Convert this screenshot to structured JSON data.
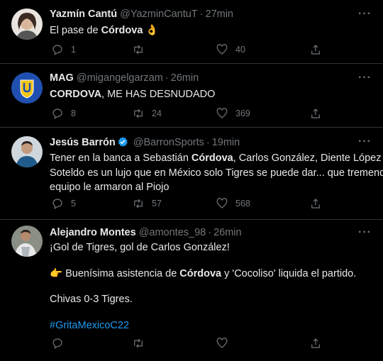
{
  "tweets": [
    {
      "name": "Yazmín Cantú",
      "handle": "@YazminCantuT",
      "time": "27min",
      "text_pre": "El pase de ",
      "text_bold": "Córdova",
      "text_post": "",
      "emoji": "👌",
      "replies": "1",
      "retweets": "",
      "likes": "40"
    },
    {
      "name": "MAG",
      "handle": "@migangelgarzam",
      "time": "26min",
      "text_bold": "CORDOVA",
      "text_post": ", ME HAS DESNUDADO",
      "replies": "8",
      "retweets": "24",
      "likes": "369"
    },
    {
      "name": "Jesús Barrón",
      "handle": "@BarronSports",
      "time": "19min",
      "line1_pre": "Tener en la banca a Sebastián ",
      "line1_bold": "Córdova",
      "line1_post": ", Carlos González, Diente López y",
      "line2": "Soteldo es un lujo que en México solo Tigres se puede dar... que tremendo",
      "line3": "equipo le armaron al Piojo",
      "replies": "5",
      "retweets": "57",
      "likes": "568"
    },
    {
      "name": "Alejandro Montes",
      "handle": "@amontes_98",
      "time": "26min",
      "line1": "¡Gol de Tigres, gol de Carlos González!",
      "line2_pre": " Buenísima asistencia de ",
      "line2_bold": "Córdova",
      "line2_post": " y 'Cocoliso' liquida el partido.",
      "line2_emoji": "👉",
      "line3": "Chivas 0-3 Tigres.",
      "hashtag": "#GritaMexicoC22",
      "replies": "",
      "retweets": "",
      "likes": ""
    }
  ],
  "more_label": "···",
  "colors": {
    "background": "#000000",
    "text": "#e7e9ea",
    "secondary": "#71767b",
    "link": "#1d9bf0",
    "border": "#2f3336",
    "verified": "#1d9bf0"
  }
}
